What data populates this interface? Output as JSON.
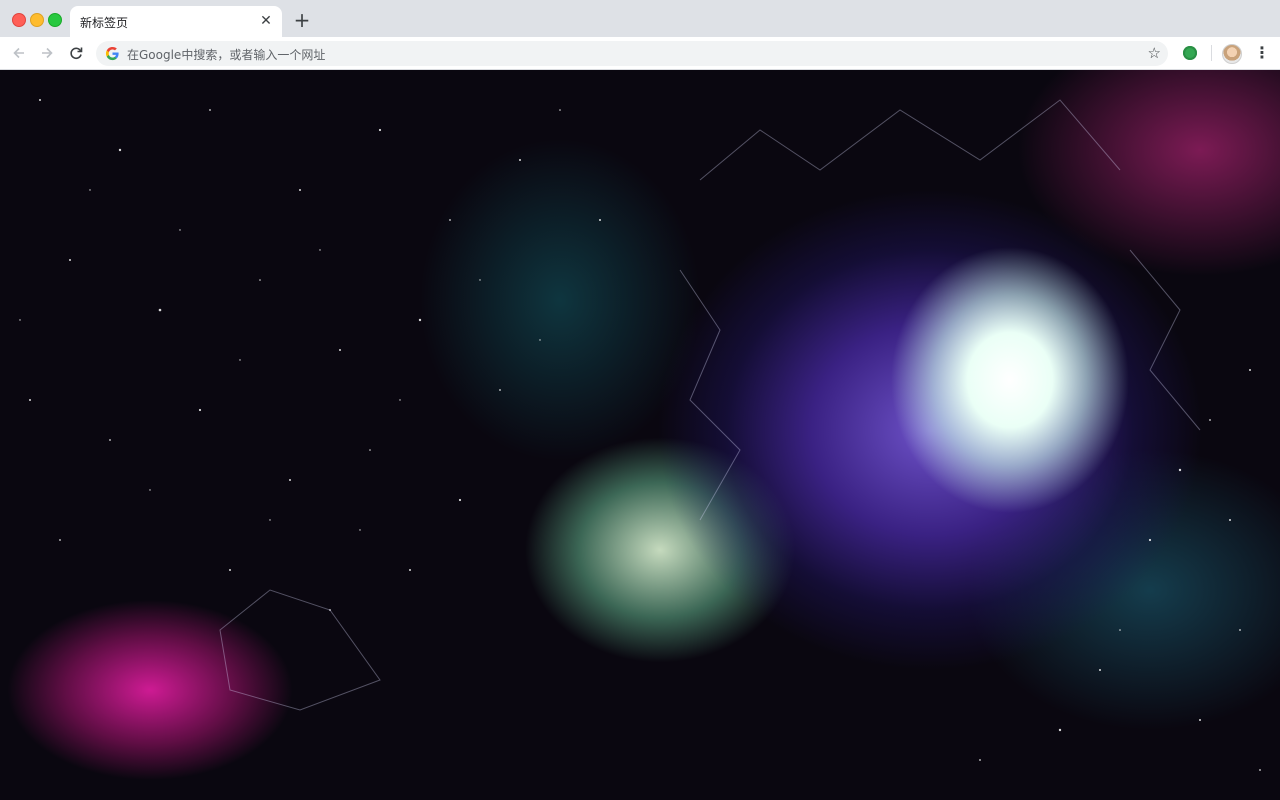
{
  "browser": {
    "tab": {
      "title": "新标签页",
      "close_icon": "close-icon"
    },
    "new_tab_icon": "plus-icon",
    "omnibox": {
      "placeholder": "在Google中搜索，或者输入一个网址",
      "search_engine_icon": "google-icon",
      "bookmark_icon": "star-icon"
    },
    "nav": {
      "back_icon": "arrow-left-icon",
      "forward_icon": "arrow-right-icon",
      "reload_icon": "reload-icon"
    },
    "extensions": [
      "green-circle-extension-icon"
    ],
    "profile_icon": "avatar",
    "menu_icon": "three-dot-menu-icon"
  },
  "colors": {
    "tabstrip": "#dee1e6",
    "toolbar": "#ffffff",
    "omnibox": "#f1f3f4",
    "wallpaper_base": "#0a0710"
  },
  "wallpaper": {
    "subject": "space-wormhole-background"
  }
}
